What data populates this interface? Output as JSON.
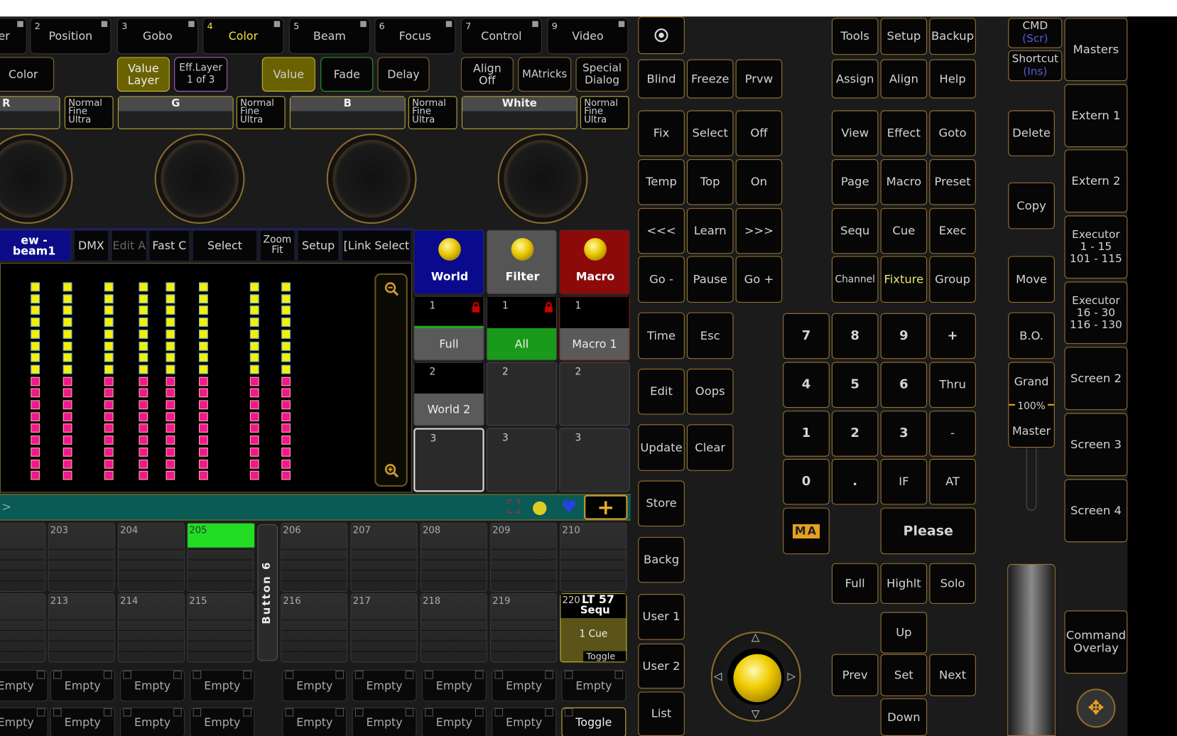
{
  "preset_tabs": [
    {
      "num": "",
      "label": "er"
    },
    {
      "num": "2",
      "label": "Position"
    },
    {
      "num": "3",
      "label": "Gobo"
    },
    {
      "num": "4",
      "label": "Color",
      "active": true
    },
    {
      "num": "5",
      "label": "Beam"
    },
    {
      "num": "6",
      "label": "Focus"
    },
    {
      "num": "7",
      "label": "Control"
    },
    {
      "num": "9",
      "label": "Video"
    }
  ],
  "preset_bar": [
    "Color",
    "Value\nLayer",
    "Eff.Layer\n1 of 3",
    "Value",
    "Fade",
    "Delay",
    "Align\nOff",
    "MAtricks",
    "Special\nDialog"
  ],
  "encoders": [
    {
      "label": "R",
      "resolution": "Normal\nFine\nUltra"
    },
    {
      "label": "G",
      "resolution": "Normal\nFine\nUltra"
    },
    {
      "label": "B",
      "resolution": "Normal\nFine\nUltra"
    },
    {
      "label": "White",
      "resolution": "Normal\nFine\nUltra"
    }
  ],
  "fixture_sheet": {
    "title": "ew - beam1",
    "tools": [
      "DMX",
      "Edit A",
      "Fast C",
      "Select",
      "Zoom\nFit",
      "Setup",
      "[Link Select"
    ]
  },
  "dmx_colors": {
    "high": "#f2f200",
    "low": "#f0188c"
  },
  "pools": {
    "headers": [
      {
        "label": "World",
        "color": "#0a0a8c"
      },
      {
        "label": "Filter",
        "color": "#555555"
      },
      {
        "label": "Macro",
        "color": "#8c0a0a"
      }
    ],
    "rows": [
      [
        {
          "num": "1",
          "label": "Full",
          "locked": true
        },
        {
          "num": "1",
          "label": "All",
          "locked": true
        },
        {
          "num": "1",
          "label": "Macro 1"
        }
      ],
      [
        {
          "num": "2",
          "label": "World 2"
        },
        {
          "num": "2",
          "label": ""
        },
        {
          "num": "2",
          "label": ""
        }
      ],
      [
        {
          "num": "3",
          "label": ""
        },
        {
          "num": "3",
          "label": ""
        },
        {
          "num": "3",
          "label": ""
        }
      ]
    ]
  },
  "executors": {
    "row1": [
      "",
      "203",
      "204",
      "205",
      "206",
      "207",
      "208",
      "209",
      "210"
    ],
    "row2": [
      "",
      "213",
      "214",
      "215",
      "216",
      "217",
      "218",
      "219"
    ],
    "divider": "Button 6",
    "special": {
      "num": "220",
      "title": "LT 57",
      "type": "Sequ",
      "cue": "1 Cue",
      "mode": "Toggle"
    },
    "active_color": "#22dd22"
  },
  "exec_buttons": {
    "row1": [
      "Empty",
      "Empty",
      "Empty",
      "Empty",
      "Empty",
      "Empty",
      "Empty",
      "Empty",
      "Empty"
    ],
    "row2": [
      "Empty",
      "Empty",
      "Empty",
      "Empty",
      "Empty",
      "Empty",
      "Empty",
      "Empty",
      "Toggle"
    ]
  },
  "mid_keys": [
    [
      "Blind",
      "Freeze",
      "Prvw"
    ],
    [
      "Fix",
      "Select",
      "Off"
    ],
    [
      "Temp",
      "Top",
      "On"
    ],
    [
      "<<<",
      "Learn",
      ">>>"
    ],
    [
      "Go -",
      "Pause",
      "Go +"
    ],
    [
      "Time",
      "Esc"
    ],
    [
      "Edit",
      "Oops"
    ],
    [
      "Update",
      "Clear"
    ],
    [
      "Store"
    ],
    [
      "Backg"
    ],
    [
      "User 1"
    ],
    [
      "User 2"
    ],
    [
      "List"
    ]
  ],
  "func_keys": [
    [
      "Tools",
      "Setup",
      "Backup"
    ],
    [
      "Assign",
      "Align",
      "Help"
    ],
    [
      "View",
      "Effect",
      "Goto"
    ],
    [
      "Page",
      "Macro",
      "Preset"
    ],
    [
      "Sequ",
      "Cue",
      "Exec"
    ],
    [
      "Channel",
      "Fixture",
      "Group"
    ]
  ],
  "numpad": [
    [
      "7",
      "8",
      "9",
      "+"
    ],
    [
      "4",
      "5",
      "6",
      "Thru"
    ],
    [
      "1",
      "2",
      "3",
      "-"
    ],
    [
      "0",
      ".",
      "IF",
      "AT"
    ]
  ],
  "please": "Please",
  "logo": "MA",
  "highlight_keys": [
    "Full",
    "Highlt",
    "Solo"
  ],
  "nav_keys": {
    "up": "Up",
    "prev": "Prev",
    "set": "Set",
    "next": "Next",
    "down": "Down"
  },
  "side_keys": {
    "cmd": "CMD",
    "cmd_sub": "(Scr)",
    "shortcut": "Shortcut",
    "shortcut_sub": "(Ins)",
    "delete": "Delete",
    "copy": "Copy",
    "move": "Move",
    "bo": "B.O.",
    "grand": "Grand",
    "grand_value": "100%",
    "master": "Master"
  },
  "view_keys": [
    "Masters",
    "Extern 1",
    "Extern 2",
    "Executor\n1 - 15\n101 - 115",
    "Executor\n16 - 30\n116 - 130",
    "Screen 2",
    "Screen 3",
    "Screen 4"
  ],
  "command_overlay": "Command\nOverlay",
  "grand_master_percent": 100
}
